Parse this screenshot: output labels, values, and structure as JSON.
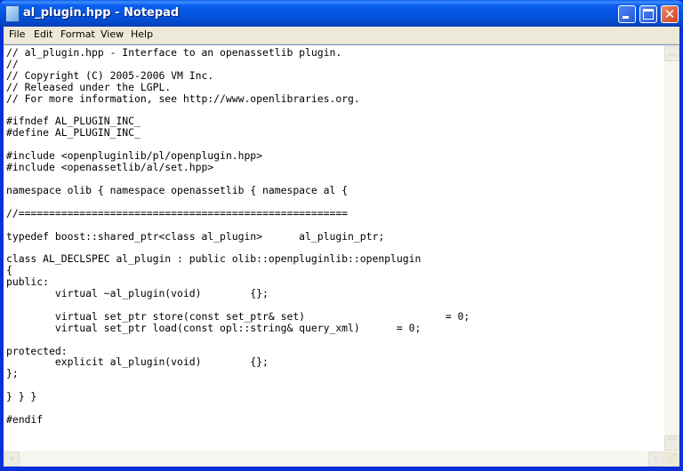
{
  "window": {
    "title": "al_plugin.hpp - Notepad",
    "controls": {
      "minimize": "minimize",
      "maximize": "maximize",
      "close": "✕"
    }
  },
  "menubar": {
    "items": [
      "File",
      "Edit",
      "Format",
      "View",
      "Help"
    ]
  },
  "editor": {
    "content": "// al_plugin.hpp - Interface to an openassetlib plugin.\n//\n// Copyright (C) 2005-2006 VM Inc.\n// Released under the LGPL.\n// For more information, see http://www.openlibraries.org.\n\n#ifndef AL_PLUGIN_INC_\n#define AL_PLUGIN_INC_\n\n#include <openpluginlib/pl/openplugin.hpp>\n#include <openassetlib/al/set.hpp>\n\nnamespace olib { namespace openassetlib { namespace al {\n\n//======================================================\n\ntypedef boost::shared_ptr<class al_plugin>      al_plugin_ptr;\n\nclass AL_DECLSPEC al_plugin : public olib::openpluginlib::openplugin\n{\npublic:\n        virtual ~al_plugin(void)        {};\n\n        virtual set_ptr store(const set_ptr& set)                       = 0;\n        virtual set_ptr load(const opl::string& query_xml)      = 0;\n\nprotected:\n        explicit al_plugin(void)        {};\n};\n\n} } }\n\n#endif"
  },
  "scrollbars": {
    "up": "︿",
    "down": "﹀",
    "left": "‹",
    "right": "›",
    "grip": "⋰"
  }
}
